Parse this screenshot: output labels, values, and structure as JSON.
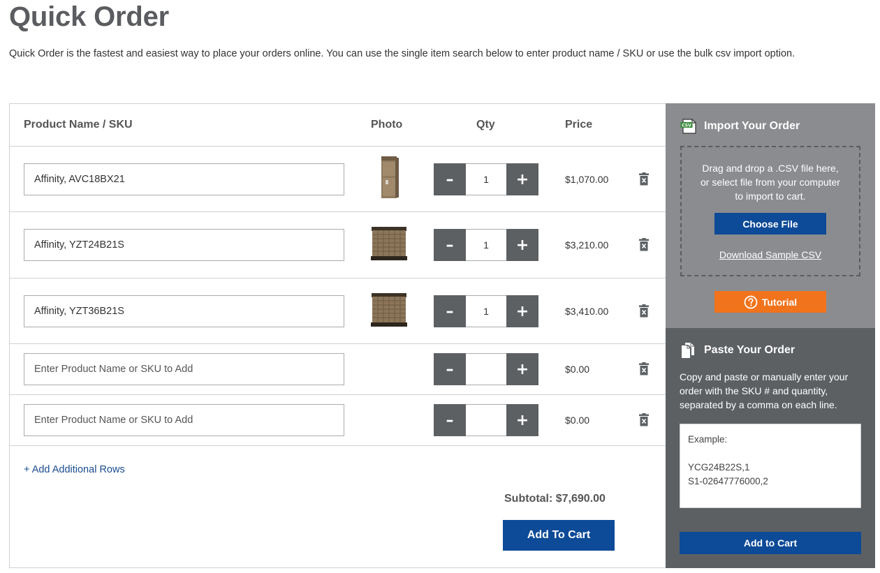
{
  "page": {
    "title": "Quick Order",
    "intro": "Quick Order is the fastest and easiest way to place your orders online. You can use the single item search below to enter product name / SKU or use the bulk csv import option."
  },
  "table": {
    "headers": {
      "name": "Product Name / SKU",
      "photo": "Photo",
      "qty": "Qty",
      "price": "Price"
    },
    "rows": [
      {
        "sku": "Affinity, AVC18BX21",
        "placeholder": "Enter Product Name or SKU to Add",
        "qty": "1",
        "price": "$1,070.00",
        "photo": "air-handler-photo"
      },
      {
        "sku": "Affinity, YZT24B21S",
        "placeholder": "Enter Product Name or SKU to Add",
        "qty": "1",
        "price": "$3,210.00",
        "photo": "condenser-unit-photo"
      },
      {
        "sku": "Affinity, YZT36B21S",
        "placeholder": "Enter Product Name or SKU to Add",
        "qty": "1",
        "price": "$3,410.00",
        "photo": "condenser-unit-photo"
      },
      {
        "sku": "",
        "placeholder": "Enter Product Name or SKU to Add",
        "qty": "",
        "price": "$0.00",
        "photo": ""
      },
      {
        "sku": "",
        "placeholder": "Enter Product Name or SKU to Add",
        "qty": "",
        "price": "$0.00",
        "photo": ""
      }
    ],
    "minus_label": "–",
    "plus_label": "+",
    "add_rows_label": "+ Add Additional Rows",
    "subtotal_label": "Subtotal: $7,690.00",
    "add_to_cart_label": "Add To Cart"
  },
  "import": {
    "title": "Import Your Order",
    "icon": "csv-file-icon",
    "drop_text_1": "Drag and drop a .CSV file here,",
    "drop_text_2": "or select file from your computer",
    "drop_text_3": "to import to cart.",
    "choose_file_label": "Choose File",
    "download_label": "Download Sample CSV",
    "tutorial_label": "Tutorial"
  },
  "paste": {
    "title": "Paste Your Order",
    "icon": "documents-icon",
    "description": "Copy and paste or manually enter your order with the SKU # and quantity, separated by a comma on each line.",
    "example_line_1": "Example:",
    "example_line_2": "YCG24B22S,1",
    "example_line_3": "S1-02647776000,2",
    "add_to_cart_label": "Add to Cart"
  },
  "colors": {
    "primary_blue": "#0d4a97",
    "tutorial_orange": "#f1731c",
    "qty_button_gray": "#5d6063",
    "import_panel_gray": "#8a8c8f",
    "paste_panel_gray": "#5d6063"
  }
}
